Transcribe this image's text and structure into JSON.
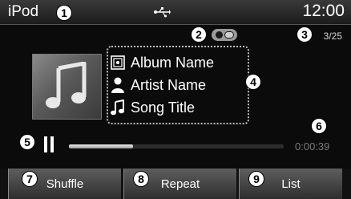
{
  "header": {
    "source": "iPod",
    "usb_icon": "usb-icon",
    "clock": "12:00"
  },
  "info": {
    "mode_icon": "repeat-shuffle-mode-icon",
    "track_counter": "3/25"
  },
  "now_playing": {
    "album_art_icon": "music-note-icon",
    "album": "Album Name",
    "artist": "Artist Name",
    "song": "Song Title"
  },
  "playback": {
    "state_icon": "pause-icon",
    "progress_fraction": 0.3,
    "elapsed": "0:00:39"
  },
  "buttons": {
    "shuffle": "Shuffle",
    "repeat": "Repeat",
    "list": "List"
  },
  "callouts": [
    "1",
    "2",
    "3",
    "4",
    "5",
    "6",
    "7",
    "8",
    "9"
  ],
  "colors": {
    "screen_bg": "#0b0b0b",
    "text": "#ffffff",
    "button_bg": "#4a4a4a"
  }
}
